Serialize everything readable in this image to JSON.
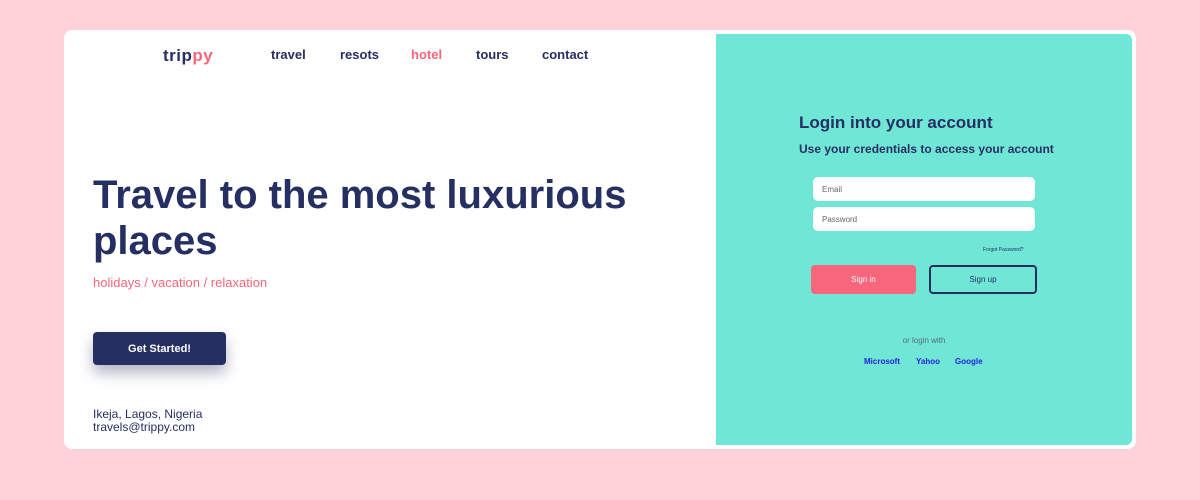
{
  "brand": {
    "name_main": "trip",
    "name_accent": "py"
  },
  "nav": {
    "items": [
      {
        "label": "travel"
      },
      {
        "label": "resots"
      },
      {
        "label": "hotel"
      },
      {
        "label": "tours"
      },
      {
        "label": "contact"
      }
    ],
    "active": "hotel"
  },
  "hero": {
    "title": "Travel to the most luxurious places",
    "subtitle": "holidays / vacation / relaxation",
    "cta_label": "Get Started!"
  },
  "footer": {
    "location": "Ikeja, Lagos, Nigeria",
    "email": "travels@trippy.com"
  },
  "login": {
    "title": "Login into your account",
    "subtitle": "Use your credentials to access your account",
    "email_placeholder": "Email",
    "password_placeholder": "Password",
    "forgot_label": "Forgot Password?",
    "signin_label": "Sign in",
    "signup_label": "Sign up",
    "or_label": "or login with",
    "providers": [
      {
        "label": "Microsoft"
      },
      {
        "label": "Yahoo"
      },
      {
        "label": "Google"
      }
    ]
  },
  "colors": {
    "page_bg": "#ffd1d9",
    "navy": "#262f62",
    "accent_pink": "#f7667a",
    "panel_teal": "#70e6d7",
    "link_blue": "#2222dd"
  }
}
